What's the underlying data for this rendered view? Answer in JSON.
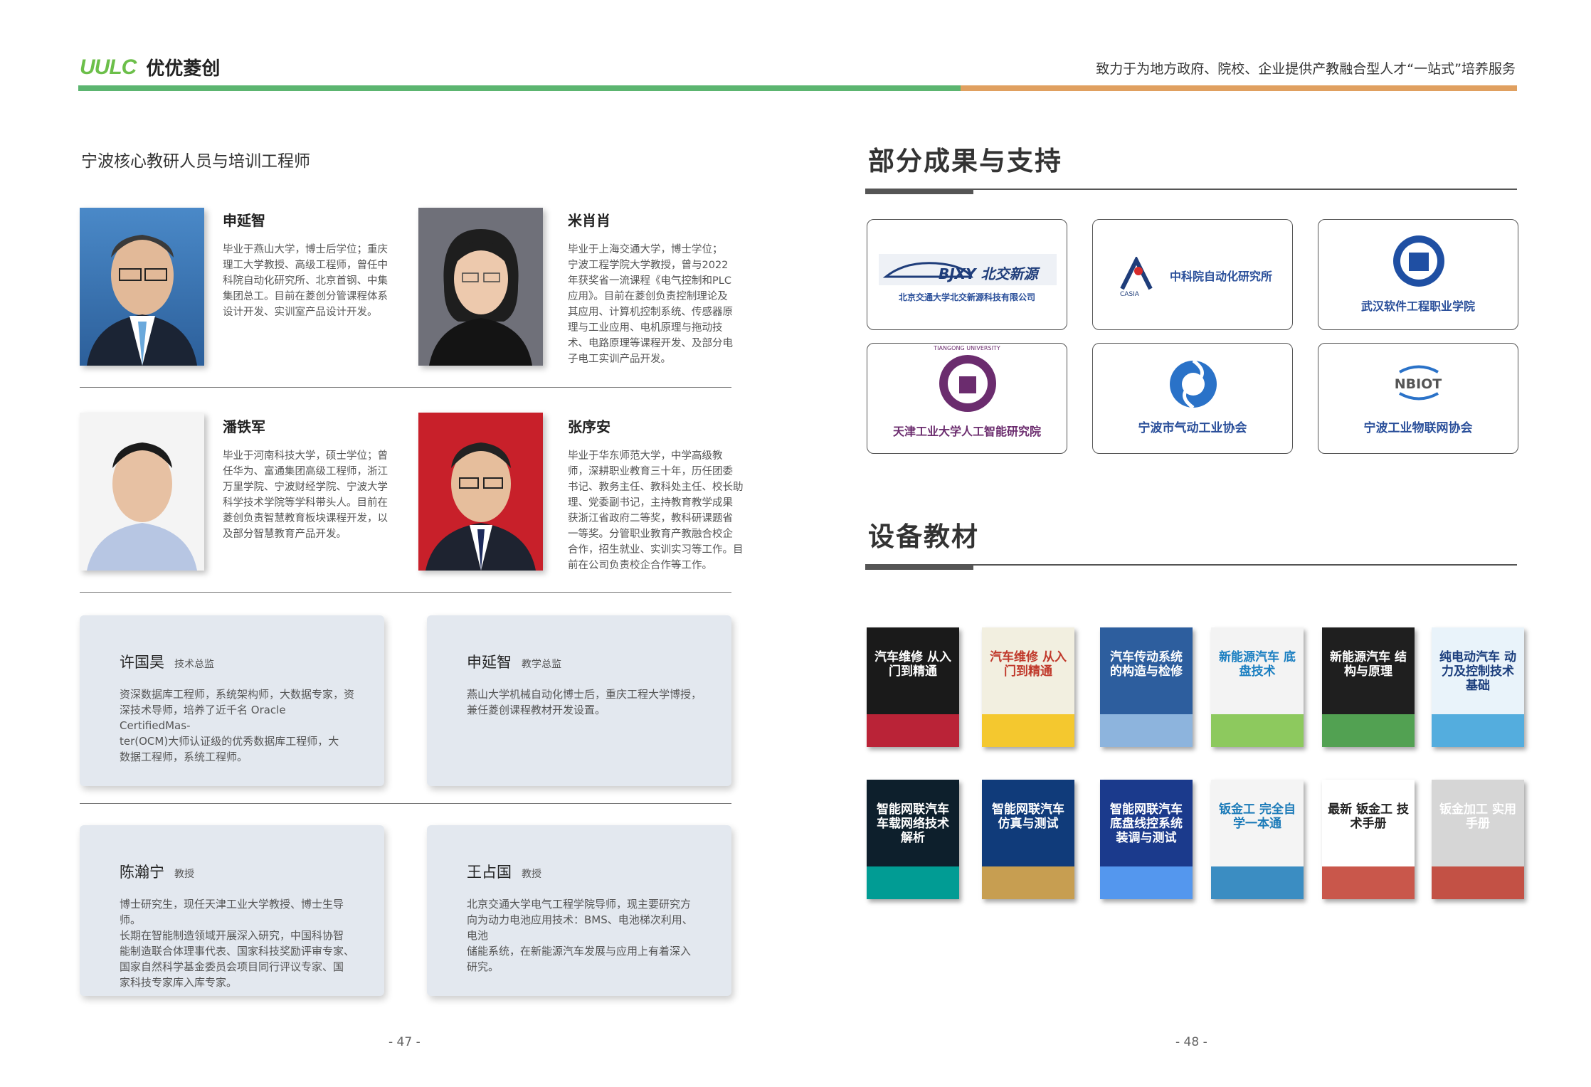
{
  "header": {
    "logo_mark": "UULC",
    "logo_text": "优优菱创",
    "tagline": "致力于为地方政府、院校、企业提供产教融合型人才“一站式”培养服务"
  },
  "left": {
    "section_title": "宁波核心教研人员与培训工程师",
    "people": [
      {
        "name": "申延智",
        "desc": [
          "毕业于燕山大学，博士后学位；重庆",
          "理工大学教授、高级工程师，曾任中",
          "科院自动化研究所、北京首钢、中集",
          "集团总工。目前在菱创分管课程体系",
          "设计开发、实训室产品设计开发。"
        ]
      },
      {
        "name": "米肖肖",
        "desc": [
          "毕业于上海交通大学，博士学位；",
          "宁波工程学院大学教授，曾与2022",
          "年获奖省一流课程《电气控制和PLC",
          "应用》。目前在菱创负责控制理论及",
          "其应用、计算机控制系统、传感器原",
          "理与工业应用、电机原理与拖动技",
          "术、电路原理等课程开发、及部分电",
          "子电工实训产品开发。"
        ]
      },
      {
        "name": "潘铁军",
        "desc": [
          "毕业于河南科技大学，硕士学位；曾",
          "任华为、富通集团高级工程师，浙江",
          "万里学院、宁波财经学院、宁波大学",
          "科学技术学院等学科带头人。目前在",
          "菱创负责智慧教育板块课程开发，以",
          "及部分智慧教育产品开发。"
        ]
      },
      {
        "name": "张序安",
        "desc": [
          "毕业于华东师范大学，中学高级教",
          "师，深耕职业教育三十年，历任团委",
          "书记、教务主任、教科处主任、校长助",
          "理、党委副书记，主持教育教学成果",
          "获浙江省政府二等奖，教科研课题省",
          "一等奖。分管职业教育产教融合校企",
          "合作，招生就业、实训实习等工作。目",
          "前在公司负责校企合作等工作。"
        ]
      }
    ],
    "cards": [
      {
        "name": "许国昊",
        "role": "技术总监",
        "desc": [
          "资深数据库工程师，系统架构师，大数据专家，资",
          "深技术导师，培养了近千名 Oracle CertifiedMas-",
          "ter(OCM)大师认证级的优秀数据库工程师，大",
          "数据工程师，系统工程师。"
        ]
      },
      {
        "name": "申延智",
        "role": "教学总监",
        "desc": [
          "燕山大学机械自动化博士后，重庆工程大学博授，",
          "兼任菱创课程教材开发设置。"
        ]
      },
      {
        "name": "陈瀚宁",
        "role": "教授",
        "desc": [
          "博士研究生，现任天津工业大学教授、博士生导师。",
          "长期在智能制造领域开展深入研究，中国科协智",
          "能制造联合体理事代表、国家科技奖励评审专家、",
          "国家自然科学基金委员会项目同行评议专家、国",
          "家科技专家库入库专家。"
        ]
      },
      {
        "name": "王占国",
        "role": "教授",
        "desc": [
          "北京交通大学电气工程学院导师，现主要研究方",
          "向为动力电池应用技术：BMS、电池梯次利用、电池",
          "储能系统，在新能源汽车发展与应用上有着深入",
          "研究。"
        ]
      }
    ],
    "page_number": "- 47 -"
  },
  "right": {
    "section1_title": "部分成果与支持",
    "partners": [
      {
        "logo_text": "BJXY 北交新源",
        "label": "北京交通大学北交新源科技有限公司",
        "icon": "car-icon"
      },
      {
        "logo_text": "CASIA",
        "label": "中科院自动化研究所",
        "icon": "a-icon"
      },
      {
        "logo_text": "",
        "label": "武汉软件工程职业学院",
        "icon": "seal-icon"
      },
      {
        "logo_text": "TIANGONG UNIVERSITY",
        "label": "天津工业大学人工智能研究院",
        "icon": "seal-icon"
      },
      {
        "logo_text": "",
        "label": "宁波市气动工业协会",
        "icon": "swirl-icon"
      },
      {
        "logo_text": "NBIOT",
        "label": "宁波工业物联网协会",
        "icon": "wave-icon"
      }
    ],
    "section2_title": "设备教材",
    "books_row1": [
      {
        "title": "汽车维修 从入门到精通",
        "bg": "#1a1a1a",
        "fg": "#ffffff",
        "accent": "#d7263d"
      },
      {
        "title": "汽车维修 从入门到精通",
        "bg": "#f2efe0",
        "fg": "#c0392b",
        "accent": "#f4c10f"
      },
      {
        "title": "汽车传动系统的构造与检修",
        "bg": "#2d5e9e",
        "fg": "#ffffff",
        "accent": "#9fc3e7"
      },
      {
        "title": "新能源汽车 底盘技术",
        "bg": "#f3f3f3",
        "fg": "#1b7fc1",
        "accent": "#7ac143"
      },
      {
        "title": "新能源汽车 结构与原理",
        "bg": "#1f1f1f",
        "fg": "#ffffff",
        "accent": "#5cb85c"
      },
      {
        "title": "纯电动汽车 动力及控制技术基础",
        "bg": "#e9f3fa",
        "fg": "#1a3d7c",
        "accent": "#3aa0d8"
      }
    ],
    "books_row2": [
      {
        "title": "智能网联汽车 车载网络技术解析",
        "bg": "#0d1f2c",
        "fg": "#ffffff",
        "accent": "#00b3a7"
      },
      {
        "title": "智能网联汽车 仿真与测试",
        "bg": "#103b7a",
        "fg": "#ffffff",
        "accent": "#e8b04a"
      },
      {
        "title": "智能网联汽车 底盘线控系统装调与测试",
        "bg": "#1b3a8c",
        "fg": "#ffffff",
        "accent": "#5ea8ff"
      },
      {
        "title": "钣金工 完全自学一本通",
        "bg": "#f4f4f4",
        "fg": "#1a7ab8",
        "accent": "#1a7ab8"
      },
      {
        "title": "最新 钣金工 技术手册",
        "bg": "#ffffff",
        "fg": "#222222",
        "accent": "#c0392b"
      },
      {
        "title": "钣金加工 实用手册",
        "bg": "#d6d6d6",
        "fg": "#ffffff",
        "accent": "#c0392b"
      }
    ],
    "page_number": "- 48 -"
  }
}
